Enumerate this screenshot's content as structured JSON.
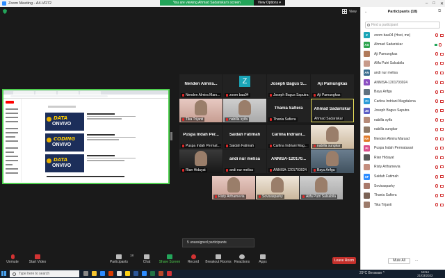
{
  "window": {
    "title": "Zoom Meeting - A4-VR72",
    "banner_text": "You are viewing Ahmad Sadariskar's screen",
    "view_options": "View Options ▾",
    "view_label": "View"
  },
  "tiles": [
    {
      "name": "Nenden Almira...",
      "label": "Nenden Almira Mars..."
    },
    {
      "name": "",
      "label": "zoom baa04",
      "avatar": "Z"
    },
    {
      "name": "Joseph Bagus S...",
      "label": "Joseph Bagus Saputra"
    },
    {
      "name": "Aji Pamungkas",
      "label": "Aji Pamungkas"
    },
    {
      "name": "",
      "label": "Tika Trijanti"
    },
    {
      "name": "",
      "label": "nabilla syifa"
    },
    {
      "name": "Thania Safiera",
      "label": "Thania Safiera"
    },
    {
      "name": "Ahmad Sadariskar",
      "label": "Ahmad Sadariskar"
    },
    {
      "name": "Puspa Indah Per...",
      "label": "Puspa Indah Permat..."
    },
    {
      "name": "Saidah Fatimah",
      "label": "Saidah Fatimah"
    },
    {
      "name": "Carlina Indriani...",
      "label": "Carlina Indriani Mag..."
    },
    {
      "name": "",
      "label": "nabilla sungkar"
    },
    {
      "name": "",
      "label": "Rian Hidayat"
    },
    {
      "name": "andi nur melisa",
      "label": "andi nur melisa"
    },
    {
      "name": "ANNISA-120170...",
      "label": "ANNISA-1201703024"
    },
    {
      "name": "",
      "label": "Bayu Arifga"
    },
    {
      "name": "",
      "label": "Risty Arthamevia"
    },
    {
      "name": "",
      "label": "Sovisasparky"
    },
    {
      "name": "",
      "label": "Alifa Putri Salsabila"
    }
  ],
  "unassigned": "5 unassigned participants",
  "toolbar": {
    "unmute": "Unmute",
    "start_video": "Start Video",
    "participants": "Participants",
    "participants_count": "18",
    "chat": "Chat",
    "share_screen": "Share Screen",
    "record": "Record",
    "breakout_rooms": "Breakout Rooms",
    "reactions": "Reactions",
    "apps": "Apps",
    "leave": "Leave Room"
  },
  "panel": {
    "title": "Participants (18)",
    "search_placeholder": "Find a participant",
    "mute_all": "Mute All",
    "more": "...",
    "participants": [
      {
        "initials": "Z",
        "name": "zoom baa04 (Host, me)",
        "color": "#1aa5b7"
      },
      {
        "initials": "AS",
        "name": "Ahmad Sadariskar",
        "color": "#2ea44f",
        "video": true
      },
      {
        "initials": "",
        "name": "Aji Pamungkas",
        "color": "#b07a5a"
      },
      {
        "initials": "",
        "name": "Alifa Putri Salsabila",
        "color": "#c79a8a"
      },
      {
        "initials": "AN",
        "name": "andi nur melisa",
        "color": "#3c6e8f"
      },
      {
        "initials": "A",
        "name": "ANNISA-1201703024",
        "color": "#8a4fc1"
      },
      {
        "initials": "",
        "name": "Bayu Arifga",
        "color": "#5f7280"
      },
      {
        "initials": "CI",
        "name": "Carlina Indriani Magdalena",
        "color": "#2b9bd7"
      },
      {
        "initials": "JB",
        "name": "Joseph Bagus Saputra",
        "color": "#5c5fc6"
      },
      {
        "initials": "",
        "name": "nabilla syifa",
        "color": "#b58a78"
      },
      {
        "initials": "",
        "name": "nabilla sungkar",
        "color": "#8f7966"
      },
      {
        "initials": "NA",
        "name": "Nenden Almira Marsad",
        "color": "#e07b2a"
      },
      {
        "initials": "PI",
        "name": "Puspa Indah Permatasari",
        "color": "#d94d8a"
      },
      {
        "initials": "",
        "name": "Rian Hidayat",
        "color": "#555555"
      },
      {
        "initials": "",
        "name": "Risty Arthamevia",
        "color": "#c48e7e"
      },
      {
        "initials": "SF",
        "name": "Saidah Fatimah",
        "color": "#2d8cff"
      },
      {
        "initials": "",
        "name": "Sovisasparky",
        "color": "#a9796a"
      },
      {
        "initials": "",
        "name": "Thania Safiera",
        "color": "#7a6255"
      },
      {
        "initials": "",
        "name": "Tika Trijanti",
        "color": "#9c7b6b"
      }
    ]
  },
  "taskbar": {
    "search_placeholder": "Type here to search",
    "weather": "29°C  Berawan  ^",
    "time": "18:54",
    "date": "21/03/2022"
  },
  "colors": {
    "accent": "#2d8cff",
    "share_green": "#23a55a",
    "leave_red": "#c4302b",
    "highlight": "#e9e05a"
  }
}
